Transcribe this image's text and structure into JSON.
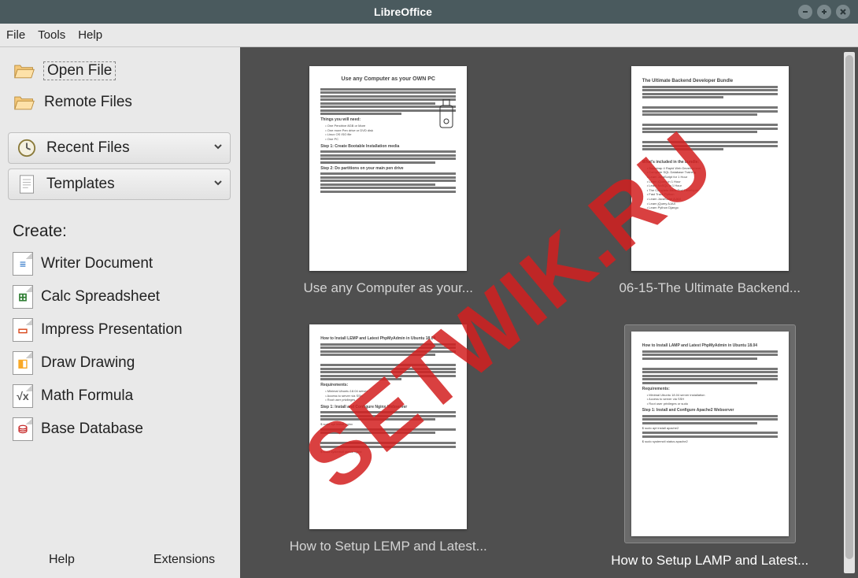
{
  "window": {
    "title": "LibreOffice"
  },
  "menubar": [
    "File",
    "Tools",
    "Help"
  ],
  "sidebar": {
    "open_file": "Open File",
    "remote_files": "Remote Files",
    "recent_files": "Recent Files",
    "templates": "Templates",
    "create_label": "Create:",
    "writer": "Writer Document",
    "calc": "Calc Spreadsheet",
    "impress": "Impress Presentation",
    "draw": "Draw Drawing",
    "math": "Math Formula",
    "base": "Base Database",
    "help": "Help",
    "extensions": "Extensions"
  },
  "docs": [
    {
      "label": "Use any Computer as your...",
      "thumb_title": "Use any Computer as your OWN PC"
    },
    {
      "label": "06-15-The Ultimate Backend...",
      "thumb_title": "The Ultimate Backend Developer Bundle"
    },
    {
      "label": "How to Setup LEMP and Latest...",
      "thumb_title": "How to Install LEMP and Latest PhpMyAdmin in Ubuntu 18.04"
    },
    {
      "label": "How to Setup LAMP and Latest...",
      "thumb_title": "How to Install LAMP and Latest PhpMyAdmin in Ubuntu 18.04"
    }
  ],
  "watermark": "SETWIK.RU"
}
